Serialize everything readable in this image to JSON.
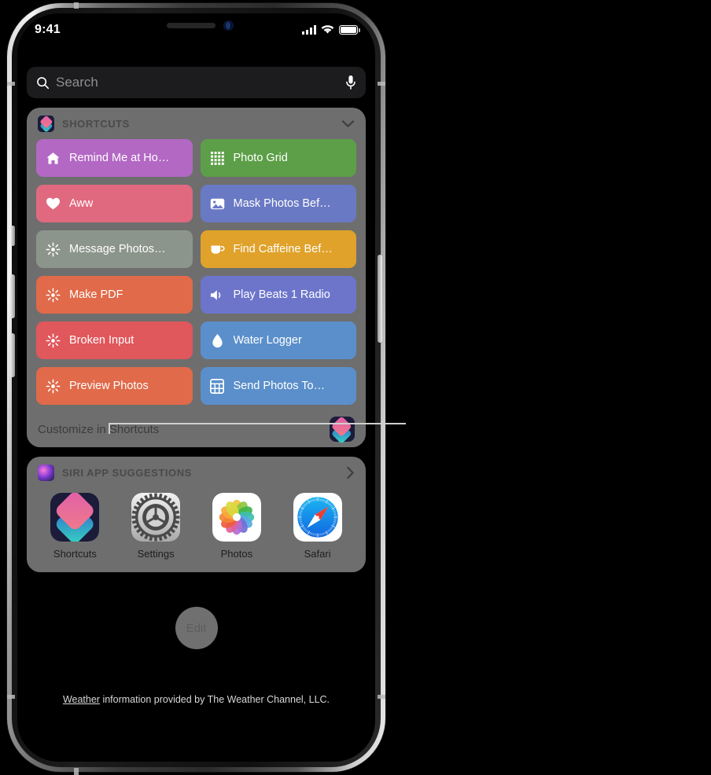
{
  "device": {
    "frame_name": "iphone-x",
    "buttons": [
      "silent-switch",
      "volume-up",
      "volume-down",
      "power"
    ]
  },
  "status_bar": {
    "time": "9:41",
    "signal_icon": "cellular-bars-icon",
    "wifi_icon": "wifi-icon",
    "battery_icon": "battery-full-icon"
  },
  "search": {
    "placeholder": "Search",
    "search_icon": "search-icon",
    "dictate_icon": "microphone-icon"
  },
  "shortcuts_widget": {
    "icon": "shortcuts-app-icon",
    "title": "SHORTCUTS",
    "collapse_icon": "chevron-down-icon",
    "tiles": [
      {
        "label": "Remind Me at Ho…",
        "icon": "house-icon",
        "color": "#b368c4"
      },
      {
        "label": "Photo Grid",
        "icon": "grid-dots-icon",
        "color": "#5c9f48"
      },
      {
        "label": "Aww",
        "icon": "heart-icon",
        "color": "#e0697f"
      },
      {
        "label": "Mask Photos Bef…",
        "icon": "photo-icon",
        "color": "#6a79c4"
      },
      {
        "label": "Message Photos…",
        "icon": "sparkle-burst-icon",
        "color": "#8c958c"
      },
      {
        "label": "Find Caffeine Bef…",
        "icon": "coffee-cup-icon",
        "color": "#e0a22a"
      },
      {
        "label": "Make PDF",
        "icon": "sparkle-burst-icon",
        "color": "#e06a4a"
      },
      {
        "label": "Play Beats 1 Radio",
        "icon": "speaker-wave-icon",
        "color": "#6d75cb"
      },
      {
        "label": "Broken Input",
        "icon": "sparkle-burst-icon",
        "color": "#e0575c"
      },
      {
        "label": "Water Logger",
        "icon": "water-drop-icon",
        "color": "#5b8fcb"
      },
      {
        "label": "Preview Photos",
        "icon": "sparkle-burst-icon",
        "color": "#e06a4a"
      },
      {
        "label": "Send Photos To…",
        "icon": "calculator-icon",
        "color": "#5b8fcb"
      }
    ],
    "customize_label": "Customize in Shortcuts",
    "customize_icon": "shortcuts-app-icon"
  },
  "siri_widget": {
    "icon": "siri-icon",
    "title": "SIRI APP SUGGESTIONS",
    "expand_icon": "chevron-right-icon",
    "apps": [
      {
        "name": "Shortcuts",
        "icon": "shortcuts-app-icon"
      },
      {
        "name": "Settings",
        "icon": "settings-app-icon"
      },
      {
        "name": "Photos",
        "icon": "photos-app-icon"
      },
      {
        "name": "Safari",
        "icon": "safari-app-icon"
      }
    ]
  },
  "edit": {
    "label": "Edit"
  },
  "footer": {
    "link_text": "Weather",
    "rest_text": " information provided by The Weather Channel, LLC."
  },
  "callout": {
    "name": "customize-in-shortcuts-callout"
  }
}
